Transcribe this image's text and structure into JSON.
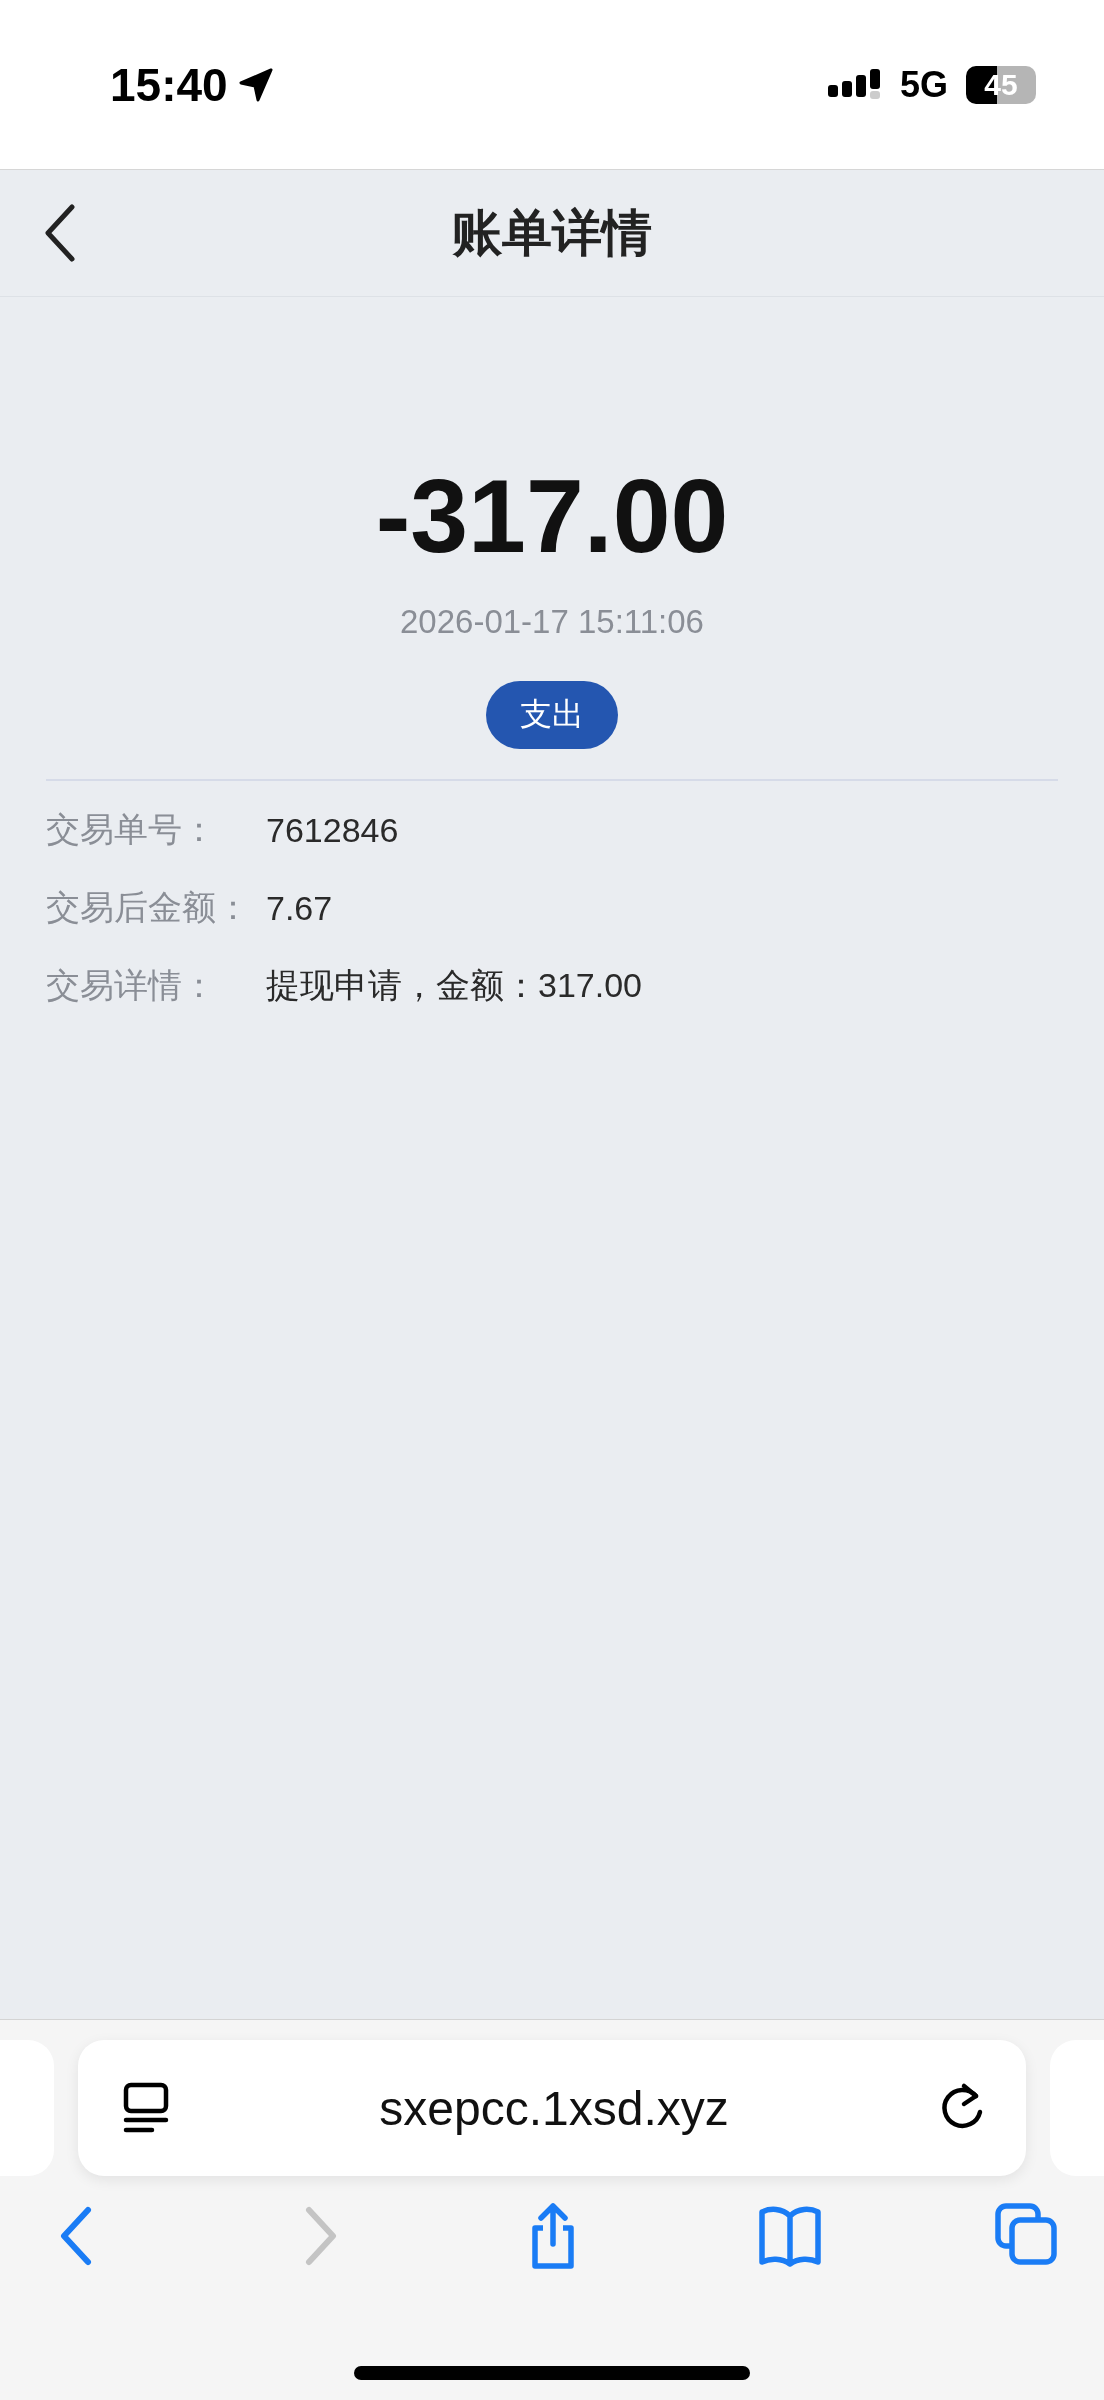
{
  "status_bar": {
    "time": "15:40",
    "network": "5G",
    "battery": "45"
  },
  "header": {
    "title": "账单详情"
  },
  "summary": {
    "amount": "-317.00",
    "datetime": "2026-01-17 15:11:06",
    "type_badge": "支出"
  },
  "details": [
    {
      "label": "交易单号：",
      "value": "7612846"
    },
    {
      "label": "交易后金额：",
      "value": "7.67"
    },
    {
      "label": "交易详情：",
      "value": "提现申请，金额：317.00"
    }
  ],
  "browser": {
    "url": "sxepcc.1xsd.xyz",
    "toolbar": [
      {
        "kind": "back",
        "disabled": false
      },
      {
        "kind": "forward",
        "disabled": true
      },
      {
        "kind": "share",
        "disabled": false
      },
      {
        "kind": "bookmarks",
        "disabled": false
      },
      {
        "kind": "tabs",
        "disabled": false
      }
    ]
  }
}
